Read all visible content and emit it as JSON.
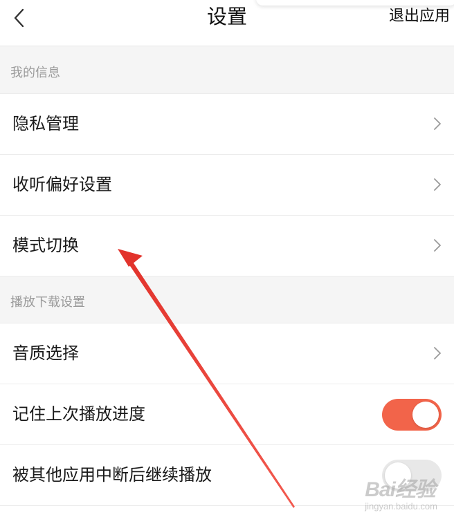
{
  "header": {
    "title": "设置",
    "exit_label": "退出应用",
    "back_icon": "chevron-left-icon"
  },
  "sections": [
    {
      "label": "我的信息",
      "items": [
        {
          "label": "隐私管理",
          "control": "chevron"
        },
        {
          "label": "收听偏好设置",
          "control": "chevron"
        },
        {
          "label": "模式切换",
          "control": "chevron"
        }
      ]
    },
    {
      "label": "播放下载设置",
      "items": [
        {
          "label": "音质选择",
          "control": "chevron"
        },
        {
          "label": "记住上次播放进度",
          "control": "toggle",
          "on": true
        },
        {
          "label": "被其他应用中断后继续播放",
          "control": "toggle",
          "on": false
        }
      ]
    }
  ],
  "colors": {
    "toggle_on": "#f2644a",
    "toggle_off": "#e8e8e8",
    "annotation_arrow": "#e8413a"
  },
  "watermark": {
    "brand": "Bai经验",
    "url": "jingyan.baidu.com"
  }
}
